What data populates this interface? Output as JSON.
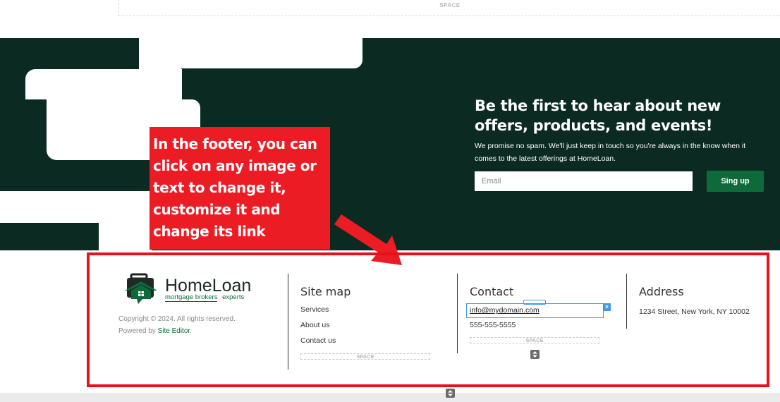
{
  "top_space": {
    "label": "SPACE"
  },
  "newsletter": {
    "title": "Be the first to hear about new offers, products, and events!",
    "subtitle": "We promise no spam. We'll just keep in touch so you're always in the know when it comes to the latest offerings at HomeLoan.",
    "email_placeholder": "Email",
    "signup_label": "Sing up"
  },
  "callout": {
    "text": "In the footer, you can click on any image or text to change it, customize it and change its link"
  },
  "brand": {
    "name_part1": "Home",
    "name_part2": "Loan",
    "tagline1": "mortgage brokers",
    "tagline2": "experts"
  },
  "footer": {
    "copyright": "Copyright © 2024. All rights reserved.",
    "powered_prefix": "Powered by ",
    "powered_link": "Site Editor",
    "powered_suffix": ".",
    "sitemap": {
      "title": "Site map",
      "links": [
        "Services",
        "About us",
        "Contact us"
      ],
      "space_label": "SPACE"
    },
    "contact": {
      "title": "Contact",
      "email": "info@mydomain.com",
      "phone": "555-555-5555",
      "space_label": "SPACE",
      "close_glyph": "×"
    },
    "address": {
      "title": "Address",
      "value": "1234 Street, New York, NY 10002"
    }
  },
  "colors": {
    "hero_bg": "#0b2b22",
    "accent_green": "#0e6a3b",
    "callout_red": "#ec1c24",
    "frame_red": "#e8111b",
    "edit_blue": "#3f9ae6"
  },
  "icons": {
    "logo": "house-briefcase-logo",
    "stepper": "up-down-stepper-icon",
    "close": "close-icon",
    "arrow": "red-arrow-pointer"
  }
}
